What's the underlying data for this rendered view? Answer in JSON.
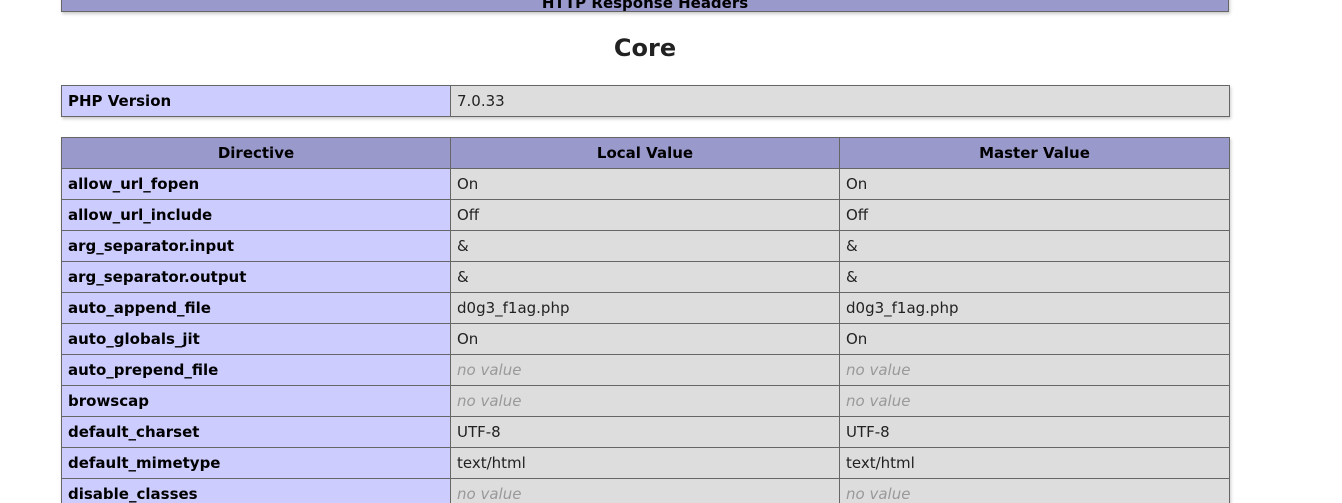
{
  "prev_section_header": "HTTP Response Headers",
  "section_title": "Core",
  "version_row": {
    "label": "PHP Version",
    "value": "7.0.33"
  },
  "columns": {
    "directive": "Directive",
    "local": "Local Value",
    "master": "Master Value"
  },
  "rows": [
    {
      "directive": "allow_url_fopen",
      "local": "On",
      "master": "On",
      "no_value": false
    },
    {
      "directive": "allow_url_include",
      "local": "Off",
      "master": "Off",
      "no_value": false
    },
    {
      "directive": "arg_separator.input",
      "local": "&",
      "master": "&",
      "no_value": false
    },
    {
      "directive": "arg_separator.output",
      "local": "&",
      "master": "&",
      "no_value": false
    },
    {
      "directive": "auto_append_file",
      "local": "d0g3_f1ag.php",
      "master": "d0g3_f1ag.php",
      "no_value": false
    },
    {
      "directive": "auto_globals_jit",
      "local": "On",
      "master": "On",
      "no_value": false
    },
    {
      "directive": "auto_prepend_file",
      "local": "no value",
      "master": "no value",
      "no_value": true
    },
    {
      "directive": "browscap",
      "local": "no value",
      "master": "no value",
      "no_value": true
    },
    {
      "directive": "default_charset",
      "local": "UTF-8",
      "master": "UTF-8",
      "no_value": false
    },
    {
      "directive": "default_mimetype",
      "local": "text/html",
      "master": "text/html",
      "no_value": false
    },
    {
      "directive": "disable_classes",
      "local": "no value",
      "master": "no value",
      "no_value": true
    }
  ],
  "colors": {
    "header_bg": "#9999cc",
    "label_bg": "#ccccff",
    "value_bg": "#dddddd",
    "no_value_text": "#999999"
  }
}
